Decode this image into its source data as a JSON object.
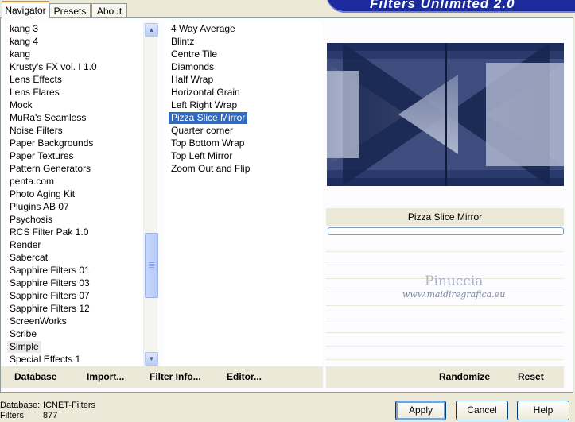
{
  "app": {
    "title": "Filters Unlimited 2.0"
  },
  "tabs": [
    {
      "label": "Navigator"
    },
    {
      "label": "Presets"
    },
    {
      "label": "About"
    }
  ],
  "categories": [
    {
      "label": "kang 3"
    },
    {
      "label": "kang 4"
    },
    {
      "label": "kang"
    },
    {
      "label": "Krusty's FX vol. I 1.0"
    },
    {
      "label": "Lens Effects"
    },
    {
      "label": "Lens Flares"
    },
    {
      "label": "Mock"
    },
    {
      "label": "MuRa's Seamless"
    },
    {
      "label": "Noise Filters"
    },
    {
      "label": "Paper Backgrounds"
    },
    {
      "label": "Paper Textures"
    },
    {
      "label": "Pattern Generators"
    },
    {
      "label": "penta.com"
    },
    {
      "label": "Photo Aging Kit"
    },
    {
      "label": "Plugins AB 07"
    },
    {
      "label": "Psychosis"
    },
    {
      "label": "RCS Filter Pak 1.0"
    },
    {
      "label": "Render"
    },
    {
      "label": "Sabercat"
    },
    {
      "label": "Sapphire Filters 01"
    },
    {
      "label": "Sapphire Filters 03"
    },
    {
      "label": "Sapphire Filters 07"
    },
    {
      "label": "Sapphire Filters 12"
    },
    {
      "label": "ScreenWorks"
    },
    {
      "label": "Scribe"
    },
    {
      "label": "Simple"
    },
    {
      "label": "Special Effects 1"
    }
  ],
  "filters": [
    {
      "label": "4 Way Average"
    },
    {
      "label": "Blintz"
    },
    {
      "label": "Centre Tile"
    },
    {
      "label": "Diamonds"
    },
    {
      "label": "Half Wrap"
    },
    {
      "label": "Horizontal Grain"
    },
    {
      "label": "Left Right Wrap"
    },
    {
      "label": "Pizza Slice Mirror"
    },
    {
      "label": "Quarter corner"
    },
    {
      "label": "Top Bottom Wrap"
    },
    {
      "label": "Top Left Mirror"
    },
    {
      "label": "Zoom Out and Flip"
    }
  ],
  "selected_category": "Simple",
  "selected_filter": "Pizza Slice Mirror",
  "toolbar": {
    "database": "Database",
    "import": "Import...",
    "filter_info": "Filter Info...",
    "editor": "Editor...",
    "randomize": "Randomize",
    "reset": "Reset"
  },
  "preview": {
    "filter_name": "Pizza Slice Mirror",
    "watermark_name": "Pinuccia",
    "watermark_url": "www.maidiregrafica.eu"
  },
  "status": {
    "database_label": "Database:",
    "database_value": "ICNET-Filters",
    "filters_label": "Filters:",
    "filters_value": "877"
  },
  "dialog": {
    "apply": "Apply",
    "cancel": "Cancel",
    "help": "Help"
  },
  "colors": {
    "accent": "#316ac5",
    "banner": "#1b2a9e",
    "preview_dark": "#1c2b5a"
  },
  "icons": {
    "scroll_up": "chevron-up-icon",
    "scroll_down": "chevron-down-icon"
  }
}
